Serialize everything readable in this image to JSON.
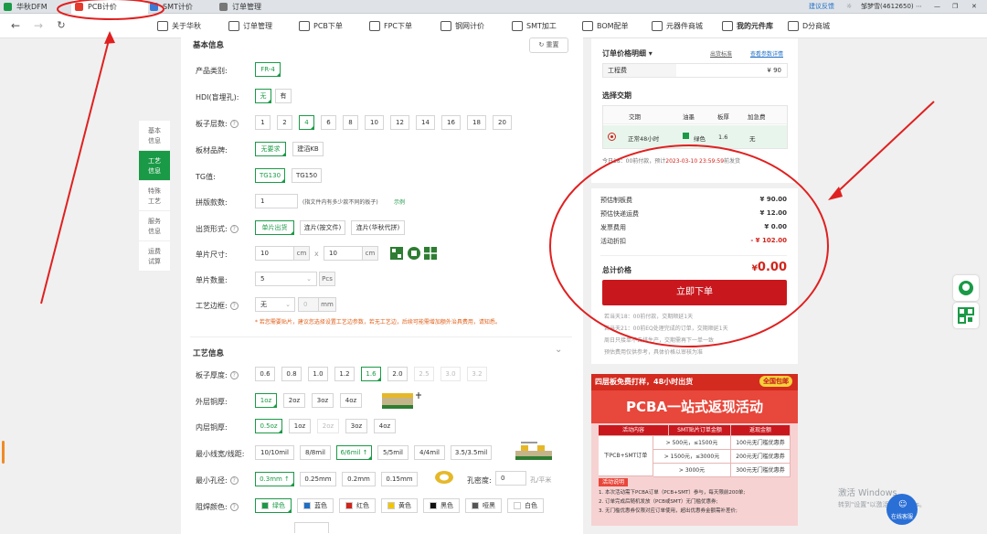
{
  "tabs": [
    {
      "label": "华秋DFM",
      "active": false
    },
    {
      "label": "PCB计价",
      "active": true
    },
    {
      "label": "SMT计价",
      "active": false
    },
    {
      "label": "订单管理",
      "active": false
    }
  ],
  "topbar": {
    "feedback": "建议反馈",
    "user": "邹梦雪(4612650)"
  },
  "nav": {
    "back": "←",
    "forward": "→",
    "reload": "↻",
    "items": [
      {
        "label": "关于华秋",
        "hl": false
      },
      {
        "label": "订单管理",
        "hl": false
      },
      {
        "label": "PCB下单",
        "hl": false
      },
      {
        "label": "FPC下单",
        "hl": false
      },
      {
        "label": "钢网计价",
        "hl": false
      },
      {
        "label": "SMT加工",
        "hl": false
      },
      {
        "label": "BOM配单",
        "hl": false
      },
      {
        "label": "元器件商城",
        "hl": false
      },
      {
        "label": "我的元件库",
        "hl": true
      },
      {
        "label": "D分商城",
        "hl": false
      }
    ]
  },
  "sidenav": [
    {
      "label": "基本信息",
      "active": false
    },
    {
      "label": "工艺信息",
      "active": true
    },
    {
      "label": "特殊工艺",
      "active": false
    },
    {
      "label": "服务信息",
      "active": false
    },
    {
      "label": "运费试算",
      "active": false
    }
  ],
  "basic": {
    "title": "基本信息",
    "reset": "重置",
    "product_label": "产品类别:",
    "product": "FR-4",
    "hdi_label": "HDI(盲埋孔):",
    "hdi_opts": [
      {
        "label": "无",
        "sel": true
      },
      {
        "label": "有",
        "sel": false
      }
    ],
    "layers_label": "板子层数:",
    "layers": [
      {
        "label": "1",
        "sel": false
      },
      {
        "label": "2",
        "sel": false
      },
      {
        "label": "4",
        "sel": true
      },
      {
        "label": "6",
        "sel": false
      },
      {
        "label": "8",
        "sel": false
      },
      {
        "label": "10",
        "sel": false
      },
      {
        "label": "12",
        "sel": false
      },
      {
        "label": "14",
        "sel": false
      },
      {
        "label": "16",
        "sel": false
      },
      {
        "label": "18",
        "sel": false
      },
      {
        "label": "20",
        "sel": false
      }
    ],
    "brand_label": "板材品牌:",
    "brand_opts": [
      {
        "label": "无要求",
        "sel": true
      },
      {
        "label": "建滔KB",
        "sel": false
      }
    ],
    "tg_label": "TG值:",
    "tg_opts": [
      {
        "label": "TG130",
        "sel": true
      },
      {
        "label": "TG150",
        "sel": false
      }
    ],
    "panel_count_label": "拼版款数:",
    "panel_count": "1",
    "panel_count_note": "(指文件内有多少款不同的板子)",
    "example": "示例",
    "ship_label": "出货形式:",
    "ship_opts": [
      {
        "label": "单片出货",
        "sel": true
      },
      {
        "label": "连片(按文件)",
        "sel": false
      },
      {
        "label": "连片(华秋代拼)",
        "sel": false
      }
    ],
    "size_label": "单片尺寸:",
    "size_w": "10",
    "size_h": "10",
    "size_unit": "cm",
    "size_x": "x",
    "qty_label": "单片数量:",
    "qty": "5",
    "qty_unit": "Pcs",
    "edge_label": "工艺边框:",
    "edge": "无",
    "edge_val": "0",
    "edge_unit": "mm",
    "notice": "* 若您需要贴片，建议您选择设置工艺边参数，若无工艺边，后续可能需增加额外治具费用，请知悉。"
  },
  "process": {
    "title": "工艺信息",
    "thick_label": "板子厚度:",
    "thick": [
      {
        "label": "0.6",
        "sel": false,
        "dis": false
      },
      {
        "label": "0.8",
        "sel": false,
        "dis": false
      },
      {
        "label": "1.0",
        "sel": false,
        "dis": false
      },
      {
        "label": "1.2",
        "sel": false,
        "dis": false
      },
      {
        "label": "1.6",
        "sel": true,
        "dis": false
      },
      {
        "label": "2.0",
        "sel": false,
        "dis": false
      },
      {
        "label": "2.5",
        "sel": false,
        "dis": true
      },
      {
        "label": "3.0",
        "sel": false,
        "dis": true
      },
      {
        "label": "3.2",
        "sel": false,
        "dis": true
      }
    ],
    "outer_label": "外层铜厚:",
    "outer": [
      {
        "label": "1oz",
        "sel": true,
        "dis": false
      },
      {
        "label": "2oz",
        "sel": false,
        "dis": false
      },
      {
        "label": "3oz",
        "sel": false,
        "dis": false
      },
      {
        "label": "4oz",
        "sel": false,
        "dis": false
      }
    ],
    "inner_label": "内层铜厚:",
    "inner": [
      {
        "label": "0.5oz",
        "sel": true,
        "dis": false
      },
      {
        "label": "1oz",
        "sel": false,
        "dis": false
      },
      {
        "label": "2oz",
        "sel": false,
        "dis": true
      },
      {
        "label": "3oz",
        "sel": false,
        "dis": false
      },
      {
        "label": "4oz",
        "sel": false,
        "dis": false
      }
    ],
    "trace_label": "最小线宽/线距:",
    "trace": [
      {
        "label": "10/10mil",
        "sel": false,
        "dis": false
      },
      {
        "label": "8/8mil",
        "sel": false,
        "dis": false
      },
      {
        "label": "6/6mil ↑",
        "sel": true,
        "dis": false
      },
      {
        "label": "5/5mil",
        "sel": false,
        "dis": false
      },
      {
        "label": "4/4mil",
        "sel": false,
        "dis": false
      },
      {
        "label": "3.5/3.5mil",
        "sel": false,
        "dis": false
      }
    ],
    "hole_label": "最小孔径:",
    "hole": [
      {
        "label": "0.3mm ↑",
        "sel": true,
        "dis": false
      },
      {
        "label": "0.25mm",
        "sel": false,
        "dis": false
      },
      {
        "label": "0.2mm",
        "sel": false,
        "dis": false
      },
      {
        "label": "0.15mm",
        "sel": false,
        "dis": false
      }
    ],
    "density_label": "孔密度:",
    "density": "0",
    "density_unit": "孔/平米",
    "mask_label": "阻焊颜色:",
    "mask": [
      {
        "label": "绿色",
        "sel": true,
        "color": "#1a9a46"
      },
      {
        "label": "蓝色",
        "sel": false,
        "color": "#1f6fc5"
      },
      {
        "label": "红色",
        "sel": false,
        "color": "#d0241c"
      },
      {
        "label": "黄色",
        "sel": false,
        "color": "#f2c500"
      },
      {
        "label": "黑色",
        "sel": false,
        "color": "#111111"
      },
      {
        "label": "哑黑",
        "sel": false,
        "color": "#555555"
      },
      {
        "label": "白色",
        "sel": false,
        "color": "#ffffff"
      }
    ]
  },
  "order": {
    "detail_title": "订单价格明细",
    "detail_std": "出货标准",
    "detail_rules": "查看参数详情",
    "eng_label": "工程费",
    "eng_value": "¥ 90",
    "delivery_title": "选择交期",
    "delivery_headers": [
      "交期",
      "油墨",
      "板厚",
      "加急费"
    ],
    "delivery_row": {
      "period": "正常48小时",
      "ink": "绿色",
      "thickness": "1.6",
      "fee": "无"
    },
    "pay_note_a": "今日18：00前付款，预计",
    "pay_note_date": "2023-03-10 23:59:59",
    "pay_note_b": "前发货",
    "fees": [
      {
        "label": "预估制板费",
        "value": "¥ 90.00",
        "red": false
      },
      {
        "label": "预估快递运费",
        "value": "¥ 12.00",
        "red": false
      },
      {
        "label": "发票费用",
        "value": "¥ 0.00",
        "red": false
      },
      {
        "label": "活动折扣",
        "value": "- ¥ 102.00",
        "red": true
      }
    ],
    "total_label": "总计价格",
    "total_currency": "¥",
    "total_value": "0.00",
    "submit": "立即下单",
    "notes": [
      {
        "text": "若当天18：00前付款，交期顺延1天"
      },
      {
        "text": "若当天21：00前EQ处理完成的订单，交期顺延1天"
      },
      {
        "text": "周日只接单不去排生产，交期需再下一单一致"
      },
      {
        "text": "预估费用仅供参考，具体价格以审核为准"
      }
    ]
  },
  "banner": {
    "top_text": "四层板免费打样，48小时出货",
    "top_tag": "全国包邮",
    "title": "PCBA一站式返现活动",
    "headers": [
      "活动内容",
      "SMT贴片订单金额",
      "返现金额"
    ],
    "label": "下PCB+SMT订单",
    "rows": [
      {
        "amount": "> 500元，≤1500元",
        "cash": "100元无门槛优惠券"
      },
      {
        "amount": "> 1500元，≤3000元",
        "cash": "200元无门槛优惠券"
      },
      {
        "amount": "> 3000元",
        "cash": "300元无门槛优惠券"
      }
    ],
    "notes_title": "活动说明",
    "notes": [
      {
        "text": "1. 本次活动需下PCBA订单（PCB+SMT）参与，每天限前200单;"
      },
      {
        "text": "2. 订单完成后随机发放（PCB或SMT）无门槛优惠券;"
      },
      {
        "text": "3. 无门槛优惠券仅限对应订单使用，超出优惠券金额需补差价;"
      }
    ]
  },
  "service": {
    "label": "在线客服"
  },
  "watermark": {
    "title": "激活 Windows",
    "sub": "转到\"设置\"以激活 Windows。"
  }
}
